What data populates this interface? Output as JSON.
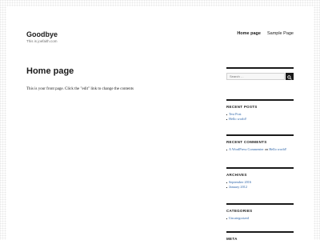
{
  "site": {
    "title": "Goodbye",
    "description": "This is joefaith.com"
  },
  "nav": {
    "items": [
      {
        "label": "Home page",
        "current": true
      },
      {
        "label": "Sample Page",
        "current": false
      }
    ]
  },
  "main": {
    "page_title": "Home page",
    "content": "This is your front page. Click the \"edit\" link to change the contents"
  },
  "sidebar": {
    "search": {
      "placeholder": "Search …",
      "button_icon": "search-icon"
    },
    "recent_posts": {
      "title": "RECENT POSTS",
      "items": [
        "Test Post",
        "Hello world!"
      ]
    },
    "recent_comments": {
      "title": "RECENT COMMENTS",
      "items": [
        {
          "author": "A WordPress Commenter",
          "connector": "on",
          "post": "Hello world!"
        }
      ]
    },
    "archives": {
      "title": "ARCHIVES",
      "items": [
        "September 2016",
        "January 2012"
      ]
    },
    "categories": {
      "title": "CATEGORIES",
      "items": [
        "Uncategorized"
      ]
    },
    "meta": {
      "title": "META"
    }
  },
  "colors": {
    "link": "#2b63a8",
    "text": "#1a1a1a",
    "frame_pattern": "#e6e6e6"
  }
}
